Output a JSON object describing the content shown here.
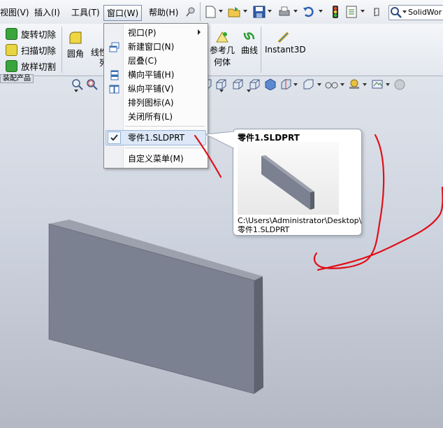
{
  "menubar": {
    "items": [
      "视图(V)",
      "插入(I)",
      "工具(T)",
      "窗口(W)",
      "帮助(H)"
    ],
    "search_text": "SolidWor"
  },
  "commands": {
    "left": [
      "旋转切除",
      "扫描切除",
      "放样切割"
    ],
    "fillet": "圆角",
    "linear_pattern": "线性",
    "linear_pattern_2": "列",
    "ref_geometry_1": "参考几",
    "ref_geometry_2": "何体",
    "curves": "曲线",
    "instant3d": "Instant3D",
    "panel_tab": "装配产品"
  },
  "window_menu": {
    "items": [
      {
        "label": "视口(P)",
        "icon": "none",
        "submenu": true
      },
      {
        "label": "新建窗口(N)",
        "icon": "new-window-icon"
      },
      {
        "label": "层叠(C)",
        "icon": "none"
      },
      {
        "label": "横向平铺(H)",
        "icon": "tile-horizontal-icon"
      },
      {
        "label": "纵向平铺(V)",
        "icon": "tile-vertical-icon"
      },
      {
        "label": "排列图标(A)",
        "icon": "none"
      },
      {
        "label": "关闭所有(L)",
        "icon": "none"
      }
    ],
    "open_document": "零件1.SLDPRT",
    "customize": "自定义菜单(M)"
  },
  "tooltip": {
    "title": "零件1.SLDPRT",
    "path_line1": "C:\\Users\\Administrator\\Desktop\\",
    "path_line2": "零件1.SLDPRT"
  },
  "colors": {
    "accent": "#3a6fb0",
    "annotation": "#e0101a",
    "part": "#7b8191"
  }
}
